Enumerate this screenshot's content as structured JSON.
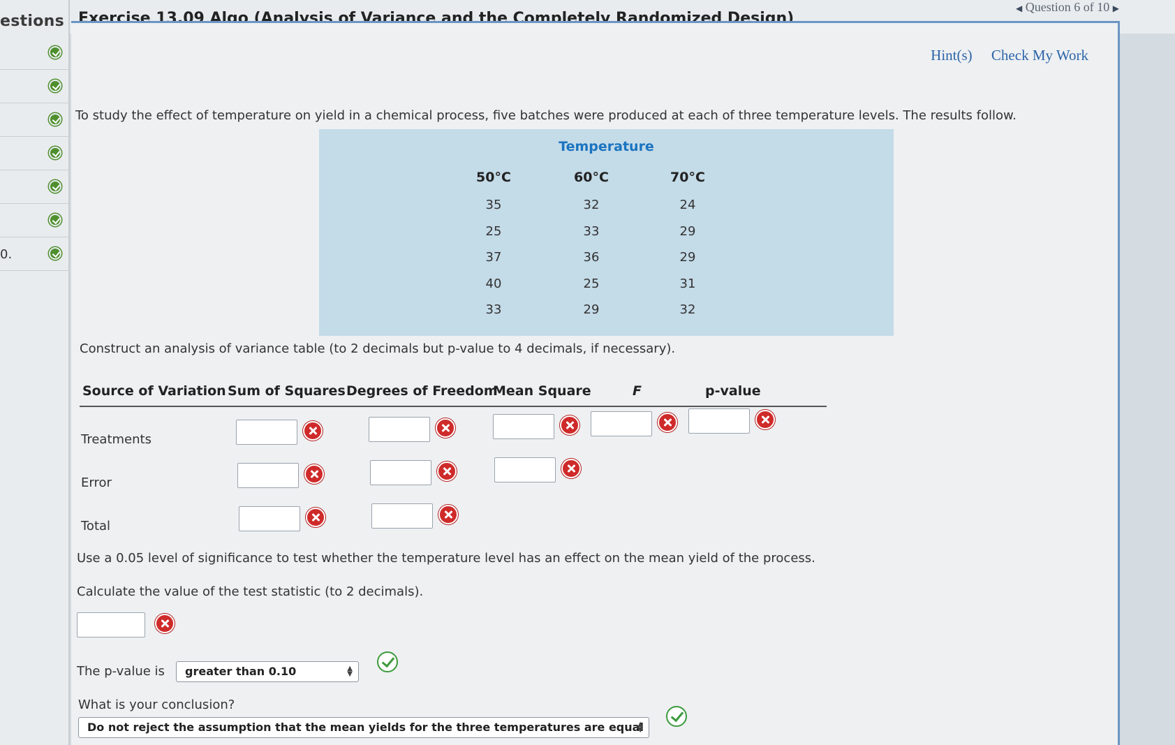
{
  "rail": {
    "header": "estions",
    "items": [
      {
        "num": ""
      },
      {
        "num": ""
      },
      {
        "num": ""
      },
      {
        "num": ""
      },
      {
        "num": ""
      },
      {
        "num": ""
      },
      {
        "num": "0."
      }
    ]
  },
  "header": {
    "title": "Exercise 13.09 Algo (Analysis of Variance and the Completely Randomized Design)",
    "question_nav": "Question 6 of 10"
  },
  "actions": {
    "hints": "Hint(s)",
    "check": "Check My Work"
  },
  "problem": {
    "intro": "To study the effect of temperature on yield in a chemical process, five batches were produced at each of three temperature levels. The results follow.",
    "table_title": "Temperature",
    "columns": [
      {
        "header": "50°C",
        "values": [
          "35",
          "25",
          "37",
          "40",
          "33"
        ]
      },
      {
        "header": "60°C",
        "values": [
          "32",
          "33",
          "36",
          "25",
          "29"
        ]
      },
      {
        "header": "70°C",
        "values": [
          "24",
          "29",
          "29",
          "31",
          "32"
        ]
      }
    ],
    "construct": "Construct an analysis of variance table (to 2 decimals but p-value to 4 decimals, if necessary)."
  },
  "anova": {
    "headers": [
      "Source of Variation",
      "Sum of Squares",
      "Degrees of Freedom",
      "Mean Square",
      "F",
      "p-value"
    ],
    "rows": [
      "Treatments",
      "Error",
      "Total"
    ]
  },
  "questions": {
    "significance": "Use a 0.05 level of significance to test whether the temperature level has an effect on the mean yield of the process.",
    "calc": "Calculate the value of the test statistic (to 2 decimals).",
    "pvalue_label": "The p-value is",
    "pvalue_selected": "greater than 0.10",
    "conclusion_label": "What is your conclusion?",
    "conclusion_selected": "Do not reject the assumption that the mean yields for the three temperatures are equal"
  }
}
